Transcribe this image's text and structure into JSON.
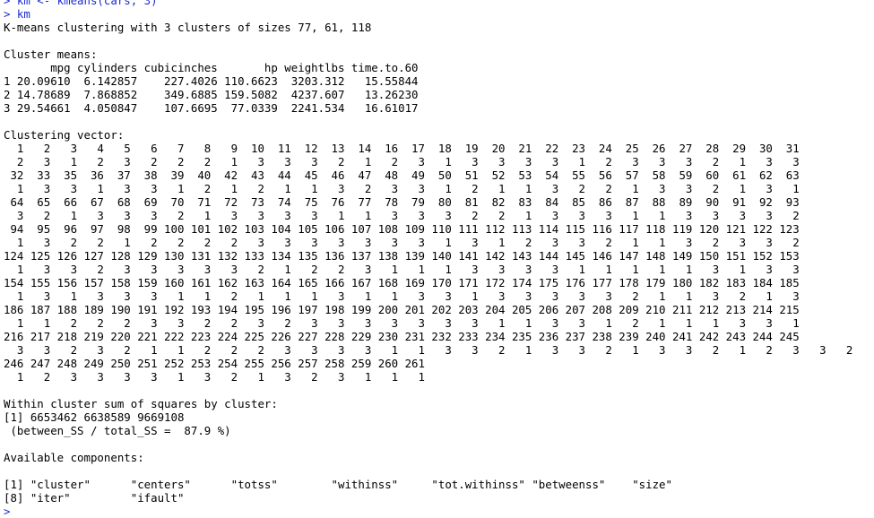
{
  "console": {
    "prev_cmd": "> km <- kmeans(cars, 3)",
    "command": "> km",
    "header": "K-means clustering with 3 clusters of sizes 77, 61, 118",
    "means_title": "Cluster means:",
    "means_header": "       mpg cylinders cubicinches       hp weightlbs time.to.60",
    "means_rows": [
      "1 20.09610  6.142857    227.4026 110.6623  3203.312   15.55844",
      "2 14.78689  7.868852    349.6885 159.5082  4237.607   13.26230",
      "3 29.54661  4.050847    107.6695  77.0339  2241.534   16.61017"
    ],
    "vector_title": "Clustering vector:",
    "vector_rows": [
      "  1   2   3   4   5   6   7   8   9  10  11  12  13  14  16  17  18  19  20  21  22  23  24  25  26  27  28  29  30  31",
      "  2   3   1   2   3   2   2   2   1   3   3   3   2   1   2   3   1   3   3   3   3   1   2   3   3   3   2   1   3   3",
      " 32  33  35  36  37  38  39  40  42  43  44  45  46  47  48  49  50  51  52  53  54  55  56  57  58  59  60  61  62  63",
      "  1   3   3   1   3   3   1   2   1   2   1   1   3   2   3   3   1   2   1   1   3   2   2   1   3   3   2   1   3   1",
      " 64  65  66  67  68  69  70  71  72  73  74  75  76  77  78  79  80  81  82  83  84  85  86  87  88  89  90  91  92  93",
      "  3   2   1   3   3   3   2   1   3   3   3   3   1   1   3   3   3   2   2   1   3   3   3   1   1   3   3   3   3   2",
      " 94  95  96  97  98  99 100 101 102 103 104 105 106 107 108 109 110 111 112 113 114 115 116 117 118 119 120 121 122 123",
      "  1   3   2   2   1   2   2   2   2   3   3   3   3   3   3   3   1   3   1   2   3   3   2   1   1   3   2   3   3   2",
      "124 125 126 127 128 129 130 131 132 133 134 135 136 137 138 139 140 141 142 143 144 145 146 147 148 149 150 151 152 153",
      "  1   3   3   2   3   3   3   3   3   2   1   2   2   3   1   1   1   3   3   3   3   1   1   1   1   1   3   1   3   3",
      "154 155 156 157 158 159 160 161 162 163 164 165 166 167 168 169 170 171 172 174 175 176 177 178 179 180 182 183 184 185",
      "  1   3   1   3   3   3   1   1   2   1   1   1   3   1   1   3   3   1   3   3   3   3   3   2   1   1   3   2   1   3",
      "186 187 188 189 190 191 192 193 194 195 196 197 198 199 200 201 202 203 204 205 206 207 208 209 210 211 212 213 214 215",
      "  1   1   2   2   2   3   3   2   2   3   2   3   3   3   3   3   3   3   1   1   3   3   1   2   1   1   1   3   3   1",
      "216 217 218 219 220 221 222 223 224 225 226 227 228 229 230 231 232 233 234 235 236 237 238 239 240 241 242 243 244 245",
      "  3   3   2   3   2   1   1   2   2   2   3   3   3   3   1   1   3   3   2   1   3   3   2   1   3   3   2   1   2   3   3   2",
      "246 247 248 249 250 251 252 253 254 255 256 257 258 259 260 261",
      "  1   2   3   3   3   3   1   3   2   1   3   2   3   1   1   1"
    ],
    "withinss_title": "Within cluster sum of squares by cluster:",
    "withinss_values": "[1] 6653462 6638589 9669108",
    "withinss_ratio": " (between_SS / total_SS =  87.9 %)",
    "components_title": "Available components:",
    "components_rows": [
      "[1] \"cluster\"      \"centers\"      \"totss\"        \"withinss\"     \"tot.withinss\" \"betweenss\"    \"size\"",
      "[8] \"iter\"         \"ifault\""
    ],
    "cursor_prompt": ">",
    "colors": {
      "command": "#1a2bd0",
      "output": "#000000",
      "background": "#ffffff"
    }
  }
}
